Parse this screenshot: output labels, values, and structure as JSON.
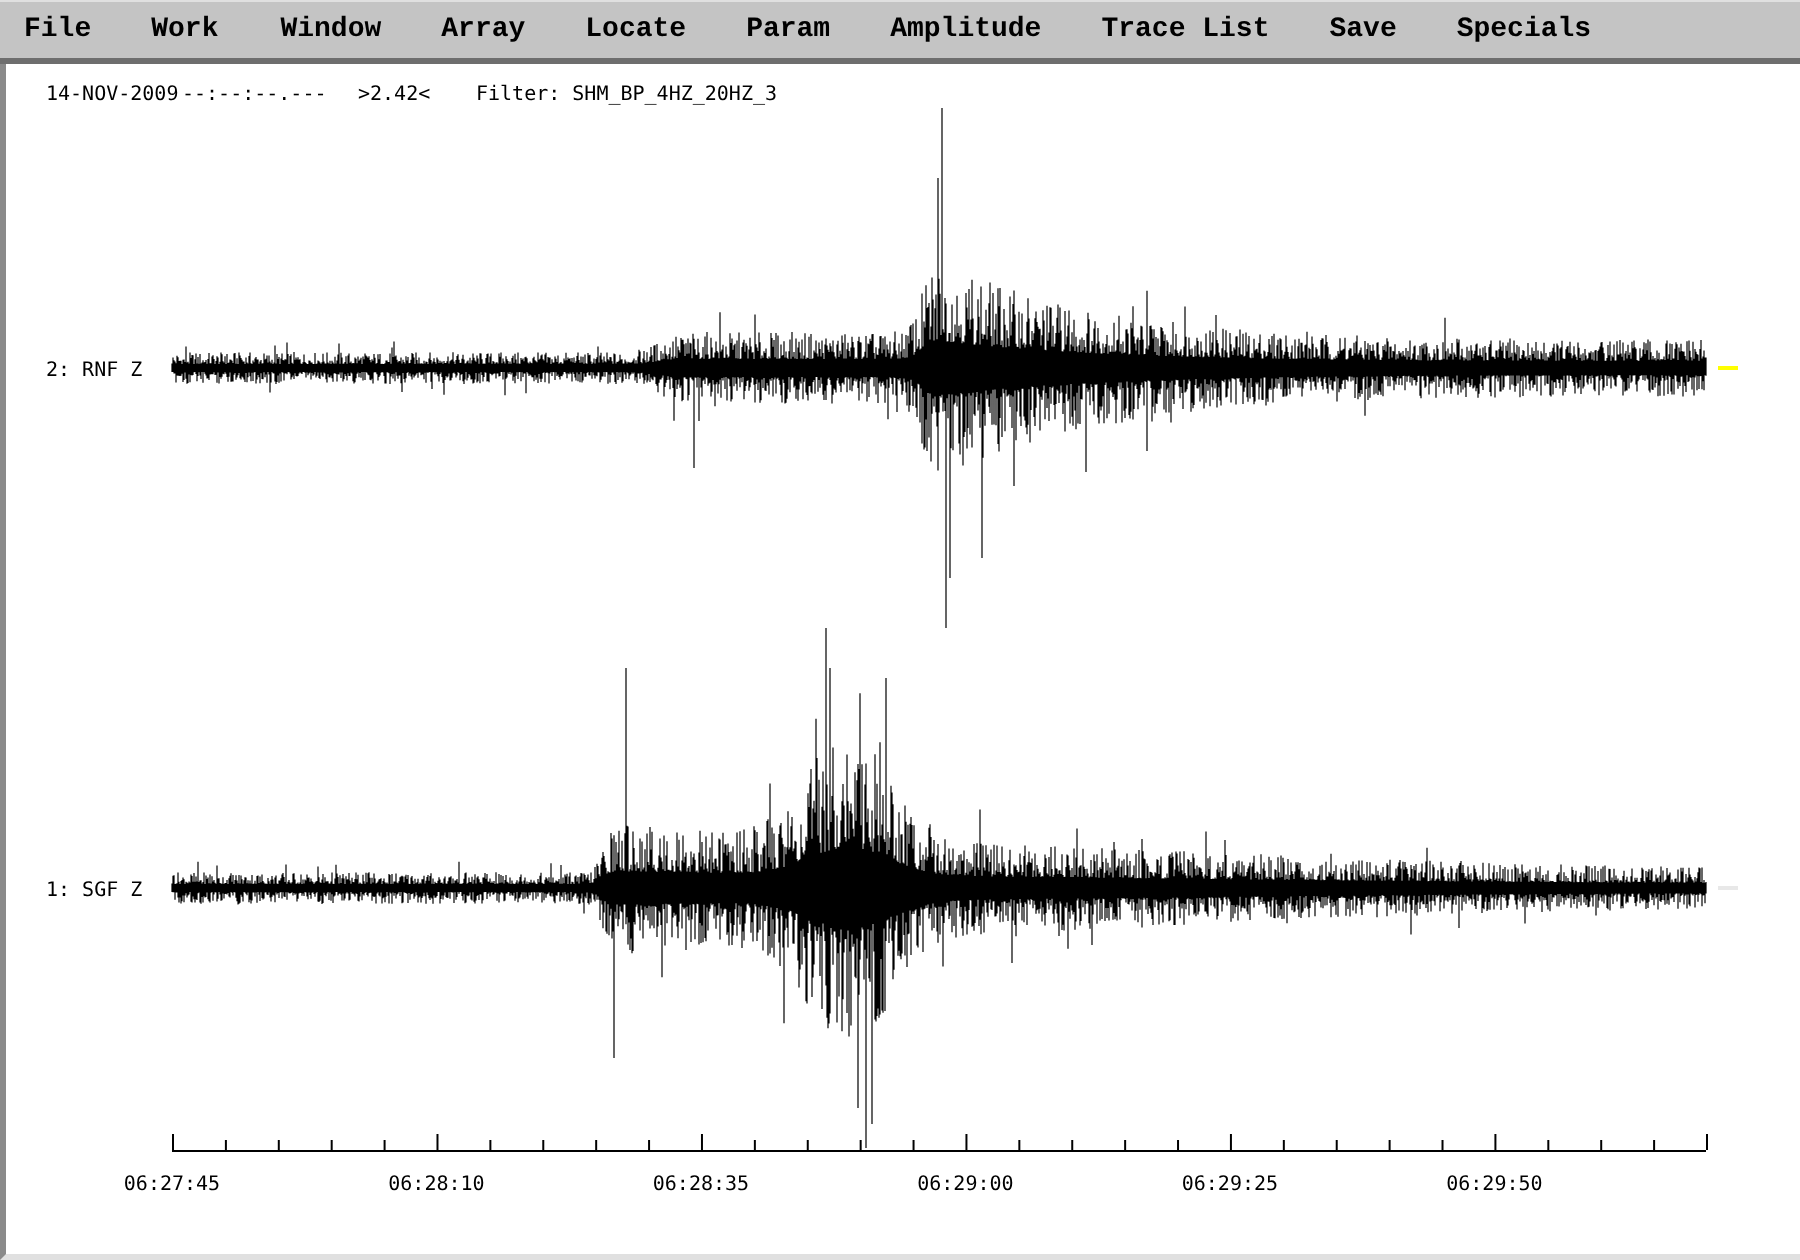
{
  "menu": [
    "File",
    "Work",
    "Window",
    "Array",
    "Locate",
    "Param",
    "Amplitude",
    "Trace List",
    "Save",
    "Specials"
  ],
  "header": {
    "date": "14-NOV-2009",
    "time": "--:--:--.---",
    "amplitude": ">2.42<",
    "filter": "Filter: SHM_BP_4HZ_20HZ_3"
  },
  "traces": [
    {
      "label": "2: RNF Z",
      "color": "#ffff00"
    },
    {
      "label": "1: SGF Z",
      "color": "#e8e8e8"
    }
  ],
  "axis": {
    "ticks": [
      "06:27:45",
      "06:28:10",
      "06:28:35",
      "06:29:00",
      "06:29:25",
      "06:29:50"
    ]
  }
}
